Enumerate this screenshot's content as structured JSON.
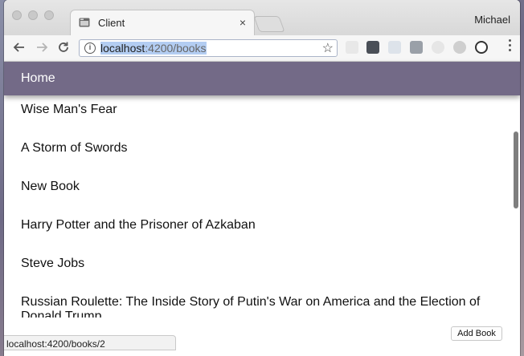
{
  "browser": {
    "tab_title": "Client",
    "tab_close": "×",
    "profile_name": "Michael",
    "url_host": "localhost",
    "url_path": ":4200/books",
    "status_url": "localhost:4200/books/2"
  },
  "app": {
    "nav_home": "Home",
    "books": [
      "Wise Man's Fear",
      "A Storm of Swords",
      "New Book",
      "Harry Potter and the Prisoner of Azkaban",
      "Steve Jobs",
      "Russian Roulette: The Inside Story of Putin's War on America and the Election of Donald Trump"
    ],
    "add_book_label": "Add Book"
  },
  "colors": {
    "header_bg": "#736a87",
    "header_text": "#ffffff"
  },
  "icons": [
    "back-arrow-icon",
    "forward-arrow-icon",
    "reload-icon",
    "info-icon",
    "star-icon",
    "menu-dots-icon"
  ]
}
